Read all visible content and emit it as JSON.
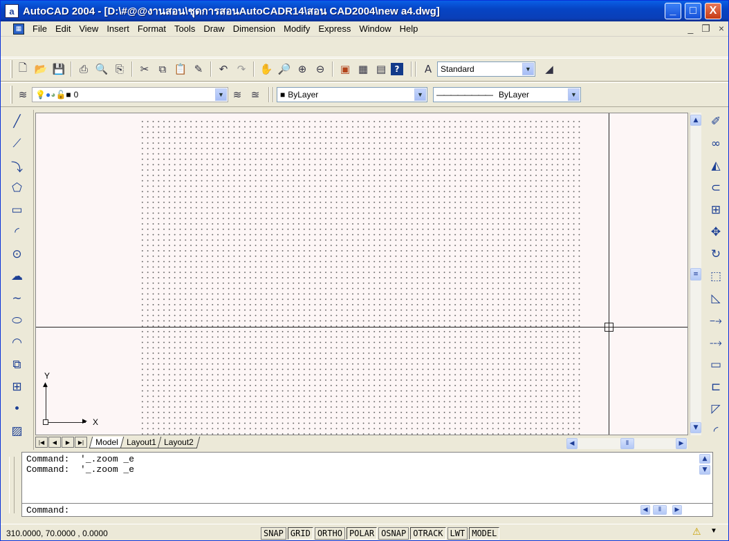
{
  "window": {
    "app_icon": "a",
    "title": "AutoCAD 2004 - [D:\\#@@งานสอน\\ชุดการสอนAutoCADR14\\สอน CAD2004\\new a4.dwg]",
    "minimize": "_",
    "maximize": "□",
    "close": "X"
  },
  "menu": {
    "items": [
      "File",
      "Edit",
      "View",
      "Insert",
      "Format",
      "Tools",
      "Draw",
      "Dimension",
      "Modify",
      "Express",
      "Window",
      "Help"
    ],
    "doc_minimize": "_",
    "doc_restore": "❐",
    "doc_close": "×"
  },
  "standard_toolbar": {
    "icons": [
      "new-icon",
      "open-icon",
      "save-icon",
      "print-icon",
      "preview-icon",
      "publish-icon",
      "cut-icon",
      "copy-icon",
      "paste-icon",
      "match-icon",
      "undo-icon",
      "redo-icon",
      "pan-icon",
      "zoom-realtime-icon",
      "zoom-window-icon",
      "zoom-previous-icon",
      "properties-icon",
      "design-center-icon",
      "tool-palette-icon",
      "help-icon"
    ],
    "text_style": "Standard"
  },
  "layers_toolbar": {
    "layer_value": "0",
    "color_value": "ByLayer",
    "linetype_value": "ByLayer"
  },
  "draw_toolbar": [
    "line-icon",
    "construction-line-icon",
    "polyline-icon",
    "polygon-icon",
    "rectangle-icon",
    "arc-icon",
    "circle-icon",
    "revision-cloud-icon",
    "spline-icon",
    "ellipse-icon",
    "ellipse-arc-icon",
    "insert-block-icon",
    "make-block-icon",
    "point-icon",
    "hatch-icon"
  ],
  "modify_toolbar": [
    "erase-icon",
    "copy-object-icon",
    "mirror-icon",
    "offset-icon",
    "array-icon",
    "move-icon",
    "rotate-icon",
    "scale-icon",
    "stretch-icon",
    "trim-icon",
    "extend-icon",
    "break-icon",
    "break-at-point-icon",
    "chamfer-icon",
    "fillet-icon"
  ],
  "ucs": {
    "y_label": "Y",
    "x_label": "X"
  },
  "tabs": {
    "items": [
      "Model",
      "Layout1",
      "Layout2"
    ],
    "active": "Model"
  },
  "command": {
    "history": [
      "Command:  '_.zoom _e",
      "Command:  '_.zoom _e"
    ],
    "prompt": "Command:"
  },
  "status": {
    "coords": "310.0000, 70.0000 , 0.0000",
    "buttons": [
      "SNAP",
      "GRID",
      "ORTHO",
      "POLAR",
      "OSNAP",
      "OTRACK",
      "LWT",
      "MODEL"
    ],
    "pressed": [
      "GRID",
      "POLAR",
      "OTRACK",
      "MODEL"
    ]
  }
}
